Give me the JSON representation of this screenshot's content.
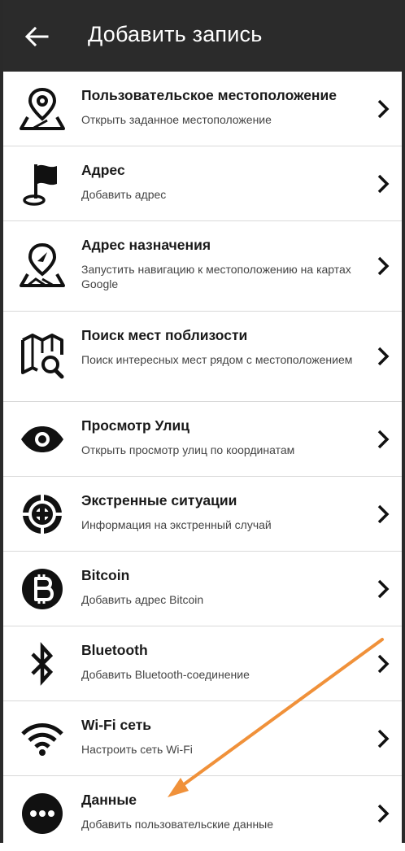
{
  "header": {
    "title": "Добавить запись",
    "back_icon": "arrow-left-icon"
  },
  "items": [
    {
      "title": "Пользовательское местоположение",
      "subtitle": "Открыть заданное местоположение",
      "icon": "map-pin-icon"
    },
    {
      "title": "Адрес",
      "subtitle": "Добавить адрес",
      "icon": "flag-icon"
    },
    {
      "title": "Адрес назначения",
      "subtitle": "Запустить навигацию к местоположению на картах Google",
      "icon": "navigation-pin-icon"
    },
    {
      "title": "Поиск мест поблизости",
      "subtitle": "Поиск интересных мест рядом с местоположением",
      "icon": "map-search-icon"
    },
    {
      "title": "Просмотр Улиц",
      "subtitle": "Открыть просмотр улиц по координатам",
      "icon": "eye-icon"
    },
    {
      "title": "Экстренные ситуации",
      "subtitle": "Информация на экстренный случай",
      "icon": "lifebuoy-icon"
    },
    {
      "title": "Bitcoin",
      "subtitle": "Добавить адрес Bitcoin",
      "icon": "bitcoin-icon"
    },
    {
      "title": "Bluetooth",
      "subtitle": "Добавить Bluetooth-соединение",
      "icon": "bluetooth-icon"
    },
    {
      "title": "Wi-Fi сеть",
      "subtitle": "Настроить сеть Wi-Fi",
      "icon": "wifi-icon"
    },
    {
      "title": "Данные",
      "subtitle": "Добавить пользовательские данные",
      "icon": "more-dots-icon"
    }
  ],
  "colors": {
    "appbar": "#2b2b2b",
    "annotation_arrow": "#f0913a"
  }
}
